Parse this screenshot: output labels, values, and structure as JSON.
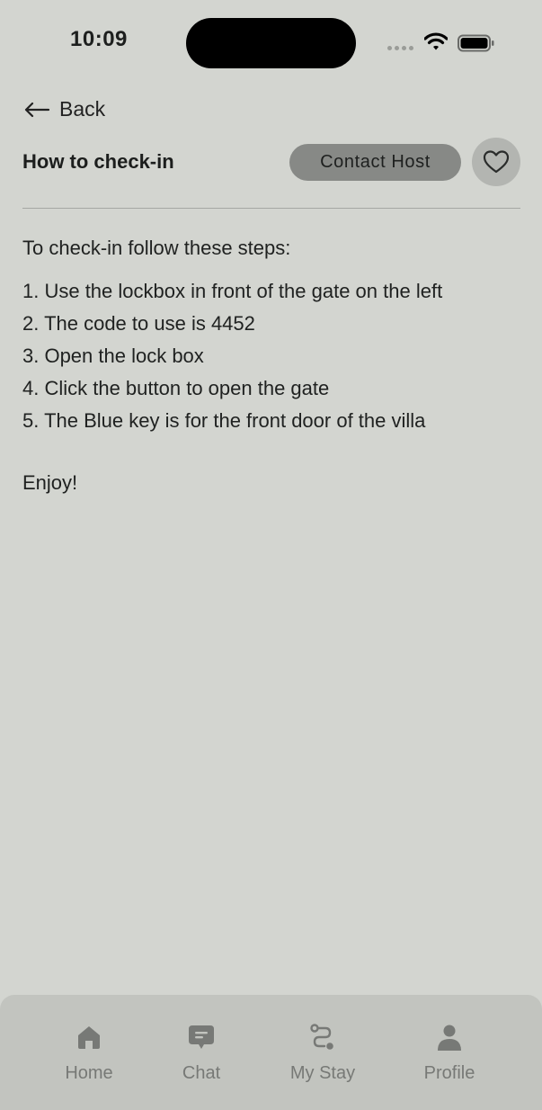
{
  "status_bar": {
    "time": "10:09"
  },
  "navigation": {
    "back_label": "Back"
  },
  "header": {
    "title": "How to check-in",
    "contact_label": "Contact Host"
  },
  "content": {
    "intro": "To check-in follow these steps:",
    "steps": [
      "1. Use the lockbox in front of the gate on the left",
      "2. The code to use is 4452",
      "3. Open the lock box",
      "4. Click the button to open the gate",
      "5. The Blue key is for the front door of the villa"
    ],
    "closing": "Enjoy!"
  },
  "tab_bar": {
    "items": [
      {
        "label": "Home",
        "icon": "home-icon"
      },
      {
        "label": "Chat",
        "icon": "chat-icon"
      },
      {
        "label": "My Stay",
        "icon": "route-icon"
      },
      {
        "label": "Profile",
        "icon": "person-icon"
      }
    ]
  },
  "colors": {
    "background": "#d3d5d0",
    "button": "#878986",
    "tab_bar": "#c2c4bf",
    "tab_inactive": "#777976"
  }
}
